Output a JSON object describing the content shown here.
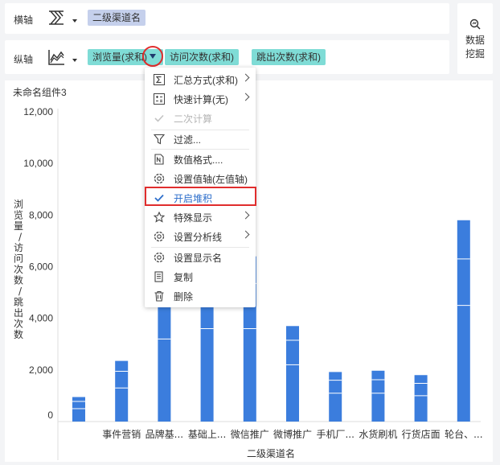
{
  "x_axis": {
    "label": "横轴",
    "icon": "dimension-axis-icon",
    "fields": [
      "二级渠道名"
    ]
  },
  "y_axis": {
    "label": "纵轴",
    "icon": "line-chart-icon",
    "fields": [
      "浏览量(求和)",
      "访问次数(求和)",
      "跳出次数(求和)"
    ]
  },
  "data_mining": {
    "label_line1": "数据",
    "label_line2": "挖掘",
    "icon": "search-analyze-icon"
  },
  "widget": {
    "title": "未命名组件3"
  },
  "context_menu": {
    "items": [
      {
        "label": "汇总方式(求和)",
        "icon": "sigma-icon",
        "submenu": true
      },
      {
        "label": "快速计算(无)",
        "icon": "calculator-icon",
        "submenu": true
      },
      {
        "label": "二次计算",
        "icon": "check-icon",
        "disabled": true
      },
      {
        "label": "过滤...",
        "icon": "filter-icon"
      },
      {
        "label": "数值格式....",
        "icon": "number-format-icon"
      },
      {
        "label": "设置值轴(左值轴)",
        "icon": "gear-icon"
      },
      {
        "label": "开启堆积",
        "icon": "check-icon",
        "active": true
      },
      {
        "label": "特殊显示",
        "icon": "star-icon",
        "submenu": true
      },
      {
        "label": "设置分析线",
        "icon": "gear-icon",
        "submenu": true
      },
      {
        "label": "设置显示名",
        "icon": "gear-icon"
      },
      {
        "label": "复制",
        "icon": "copy-icon"
      },
      {
        "label": "删除",
        "icon": "trash-icon"
      }
    ]
  },
  "colors": {
    "bar": "#3b7ddd",
    "pill_dimension": "#c5d0ec",
    "pill_measure": "#7fdcd6",
    "accent": "#2c6ecb",
    "callout": "#e02d2d"
  },
  "chart_data": {
    "type": "bar",
    "stacked": true,
    "ylabel": "浏览量/访问次数/跳出次数",
    "xlabel": "二级渠道名",
    "ylim": [
      0,
      12000
    ],
    "yticks": [
      "0",
      "2,000",
      "4,000",
      "6,000",
      "8,000",
      "10,000",
      "12,000"
    ],
    "categories": [
      "",
      "事件营销",
      "品牌基...",
      "基础上...",
      "微信推广",
      "微博推广",
      "手机厂...",
      "水货刷机",
      "行货店面",
      "轮台、..."
    ],
    "series": [
      {
        "values": [
          500,
          1300,
          3200,
          3600,
          3600,
          2200,
          1100,
          1100,
          1000,
          4500
        ]
      },
      {
        "values": [
          280,
          650,
          1550,
          1750,
          1750,
          950,
          500,
          520,
          480,
          1800
        ]
      },
      {
        "values": [
          170,
          400,
          1250,
          1050,
          1050,
          550,
          320,
          350,
          320,
          1500
        ]
      }
    ]
  }
}
